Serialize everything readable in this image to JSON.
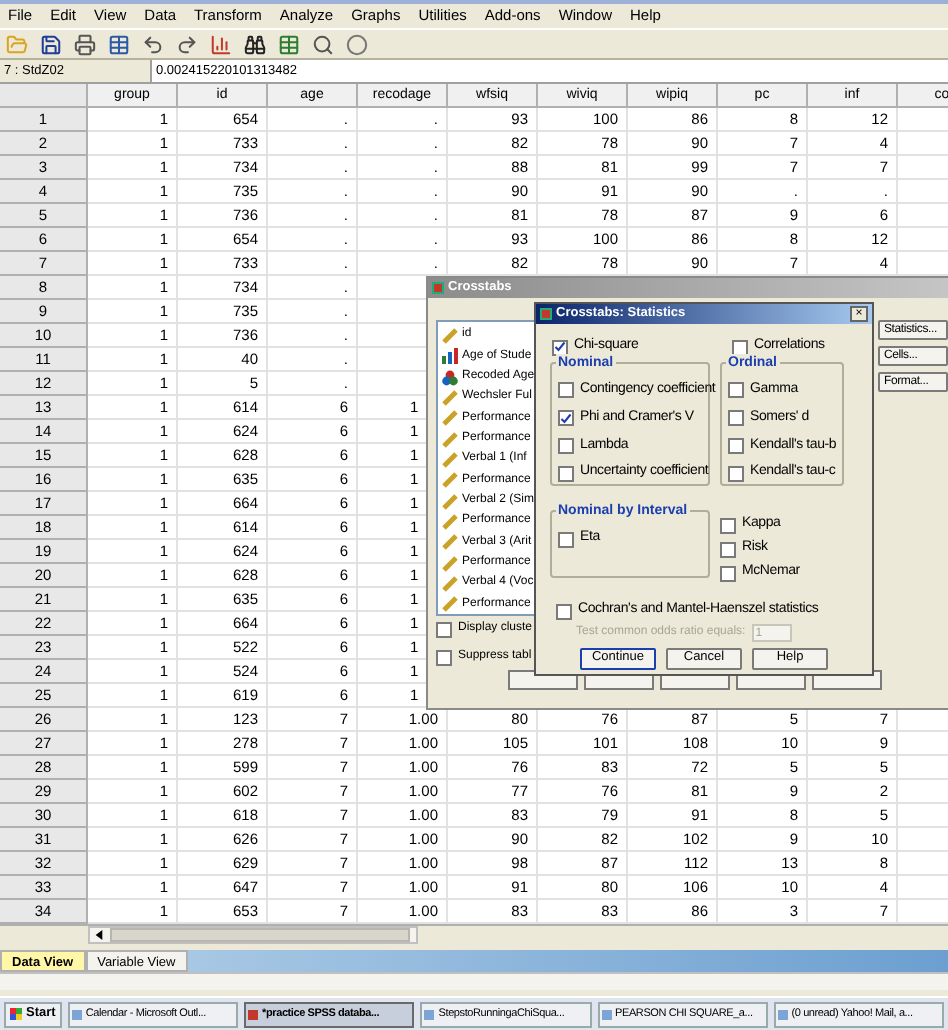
{
  "menu": [
    "File",
    "Edit",
    "View",
    "Data",
    "Transform",
    "Analyze",
    "Graphs",
    "Utilities",
    "Add-ons",
    "Window",
    "Help"
  ],
  "cell_editor": {
    "cell": "7 : StdZ02",
    "value": "0.002415220101313482"
  },
  "table": {
    "columns": [
      "group",
      "id",
      "age",
      "recodage",
      "wfsiq",
      "wiviq",
      "wipiq",
      "pc",
      "inf",
      "co"
    ],
    "rows": [
      {
        "number": "1",
        "cells": [
          "1",
          "654",
          ".",
          ".",
          "93",
          "100",
          "86",
          "8",
          "12"
        ]
      },
      {
        "number": "2",
        "cells": [
          "1",
          "733",
          ".",
          ".",
          "82",
          "78",
          "90",
          "7",
          "4"
        ]
      },
      {
        "number": "3",
        "cells": [
          "1",
          "734",
          ".",
          ".",
          "88",
          "81",
          "99",
          "7",
          "7"
        ]
      },
      {
        "number": "4",
        "cells": [
          "1",
          "735",
          ".",
          ".",
          "90",
          "91",
          "90",
          ".",
          "."
        ]
      },
      {
        "number": "5",
        "cells": [
          "1",
          "736",
          ".",
          ".",
          "81",
          "78",
          "87",
          "9",
          "6"
        ]
      },
      {
        "number": "6",
        "cells": [
          "1",
          "654",
          ".",
          ".",
          "93",
          "100",
          "86",
          "8",
          "12"
        ]
      },
      {
        "number": "7",
        "cells": [
          "1",
          "733",
          ".",
          ".",
          "82",
          "78",
          "90",
          "7",
          "4"
        ]
      },
      {
        "number": "8",
        "cells": [
          "1",
          "734",
          "."
        ]
      },
      {
        "number": "9",
        "cells": [
          "1",
          "735",
          "."
        ]
      },
      {
        "number": "10",
        "cells": [
          "1",
          "736",
          "."
        ]
      },
      {
        "number": "11",
        "cells": [
          "1",
          "40",
          "."
        ]
      },
      {
        "number": "12",
        "cells": [
          "1",
          "5",
          "."
        ]
      },
      {
        "number": "13",
        "cells": [
          "1",
          "614",
          "6",
          "1"
        ],
        "cut": true
      },
      {
        "number": "14",
        "cells": [
          "1",
          "624",
          "6",
          "1"
        ],
        "cut": true
      },
      {
        "number": "15",
        "cells": [
          "1",
          "628",
          "6",
          "1"
        ],
        "cut": true
      },
      {
        "number": "16",
        "cells": [
          "1",
          "635",
          "6",
          "1"
        ],
        "cut": true
      },
      {
        "number": "17",
        "cells": [
          "1",
          "664",
          "6",
          "1"
        ],
        "cut": true
      },
      {
        "number": "18",
        "cells": [
          "1",
          "614",
          "6",
          "1"
        ],
        "cut": true
      },
      {
        "number": "19",
        "cells": [
          "1",
          "624",
          "6",
          "1"
        ],
        "cut": true
      },
      {
        "number": "20",
        "cells": [
          "1",
          "628",
          "6",
          "1"
        ],
        "cut": true
      },
      {
        "number": "21",
        "cells": [
          "1",
          "635",
          "6",
          "1"
        ],
        "cut": true
      },
      {
        "number": "22",
        "cells": [
          "1",
          "664",
          "6",
          "1"
        ],
        "cut": true
      },
      {
        "number": "23",
        "cells": [
          "1",
          "522",
          "6",
          "1"
        ],
        "cut": true
      },
      {
        "number": "24",
        "cells": [
          "1",
          "524",
          "6",
          "1"
        ],
        "cut": true
      },
      {
        "number": "25",
        "cells": [
          "1",
          "619",
          "6",
          "1"
        ],
        "cut": true
      },
      {
        "number": "26",
        "cells": [
          "1",
          "123",
          "7",
          "1.00",
          "80",
          "76",
          "87",
          "5",
          "7"
        ]
      },
      {
        "number": "27",
        "cells": [
          "1",
          "278",
          "7",
          "1.00",
          "105",
          "101",
          "108",
          "10",
          "9"
        ]
      },
      {
        "number": "28",
        "cells": [
          "1",
          "599",
          "7",
          "1.00",
          "76",
          "83",
          "72",
          "5",
          "5"
        ]
      },
      {
        "number": "29",
        "cells": [
          "1",
          "602",
          "7",
          "1.00",
          "77",
          "76",
          "81",
          "9",
          "2"
        ]
      },
      {
        "number": "30",
        "cells": [
          "1",
          "618",
          "7",
          "1.00",
          "83",
          "79",
          "91",
          "8",
          "5"
        ]
      },
      {
        "number": "31",
        "cells": [
          "1",
          "626",
          "7",
          "1.00",
          "90",
          "82",
          "102",
          "9",
          "10"
        ]
      },
      {
        "number": "32",
        "cells": [
          "1",
          "629",
          "7",
          "1.00",
          "98",
          "87",
          "112",
          "13",
          "8"
        ]
      },
      {
        "number": "33",
        "cells": [
          "1",
          "647",
          "7",
          "1.00",
          "91",
          "80",
          "106",
          "10",
          "4"
        ]
      },
      {
        "number": "34",
        "cells": [
          "1",
          "653",
          "7",
          "1.00",
          "83",
          "83",
          "86",
          "3",
          "7"
        ]
      }
    ]
  },
  "tabs": [
    {
      "label": "Data View",
      "selected": true
    },
    {
      "label": "Variable View",
      "selected": false
    }
  ],
  "crosstabs": {
    "title": "Crosstabs",
    "variables": [
      {
        "label": "id",
        "kind": "scale"
      },
      {
        "label": "Age of Stude",
        "kind": "ordinal"
      },
      {
        "label": "Recoded Age",
        "kind": "nominal"
      },
      {
        "label": "Wechsler Ful",
        "kind": "scale"
      },
      {
        "label": "Performance",
        "kind": "scale"
      },
      {
        "label": "Performance",
        "kind": "scale"
      },
      {
        "label": "Verbal 1 (Inf",
        "kind": "scale"
      },
      {
        "label": "Performance",
        "kind": "scale"
      },
      {
        "label": "Verbal 2 (Sim",
        "kind": "scale"
      },
      {
        "label": "Performance",
        "kind": "scale"
      },
      {
        "label": "Verbal 3 (Arit",
        "kind": "scale"
      },
      {
        "label": "Performance",
        "kind": "scale"
      },
      {
        "label": "Verbal 4 (Voc",
        "kind": "scale"
      },
      {
        "label": "Performance",
        "kind": "scale"
      }
    ],
    "checkboxes": [
      {
        "label": "Display cluste",
        "checked": false
      },
      {
        "label": "Suppress tabl",
        "checked": false
      }
    ],
    "buttons": [
      "Statistics...",
      "Cells...",
      "Format..."
    ]
  },
  "statistics": {
    "title": "Crosstabs: Statistics",
    "close": "×",
    "chi_square": {
      "label": "Chi-square",
      "checked": true
    },
    "correlations": {
      "label": "Correlations",
      "checked": false
    },
    "nominal": {
      "title": "Nominal",
      "options": [
        {
          "label": "Contingency coefficient",
          "checked": false
        },
        {
          "label": "Phi and Cramer's V",
          "checked": true
        },
        {
          "label": "Lambda",
          "checked": false
        },
        {
          "label": "Uncertainty coefficient",
          "checked": false
        }
      ]
    },
    "ordinal": {
      "title": "Ordinal",
      "options": [
        {
          "label": "Gamma",
          "checked": false
        },
        {
          "label": "Somers' d",
          "checked": false
        },
        {
          "label": "Kendall's tau-b",
          "checked": false
        },
        {
          "label": "Kendall's tau-c",
          "checked": false
        }
      ]
    },
    "nominal_by_interval": {
      "title": "Nominal by Interval",
      "options": [
        {
          "label": "Eta",
          "checked": false
        }
      ]
    },
    "other": [
      {
        "label": "Kappa",
        "checked": false
      },
      {
        "label": "Risk",
        "checked": false
      },
      {
        "label": "McNemar",
        "checked": false
      }
    ],
    "cochran": {
      "label": "Cochran's and Mantel-Haenszel statistics",
      "checked": false
    },
    "odds": {
      "label": "Test common odds ratio equals:",
      "value": "1",
      "disabled": true
    },
    "buttons": [
      "Continue",
      "Cancel",
      "Help"
    ]
  },
  "taskbar": {
    "start": "Start",
    "tasks": [
      {
        "label": "Calendar - Microsoft Outl...",
        "active": false
      },
      {
        "label": "*practice SPSS databa...",
        "active": true
      },
      {
        "label": "StepstoRunningaChiSqua...",
        "active": false
      },
      {
        "label": "PEARSON CHI SQUARE_a...",
        "active": false
      },
      {
        "label": "(0 unread) Yahoo! Mail, a...",
        "active": false
      }
    ]
  }
}
